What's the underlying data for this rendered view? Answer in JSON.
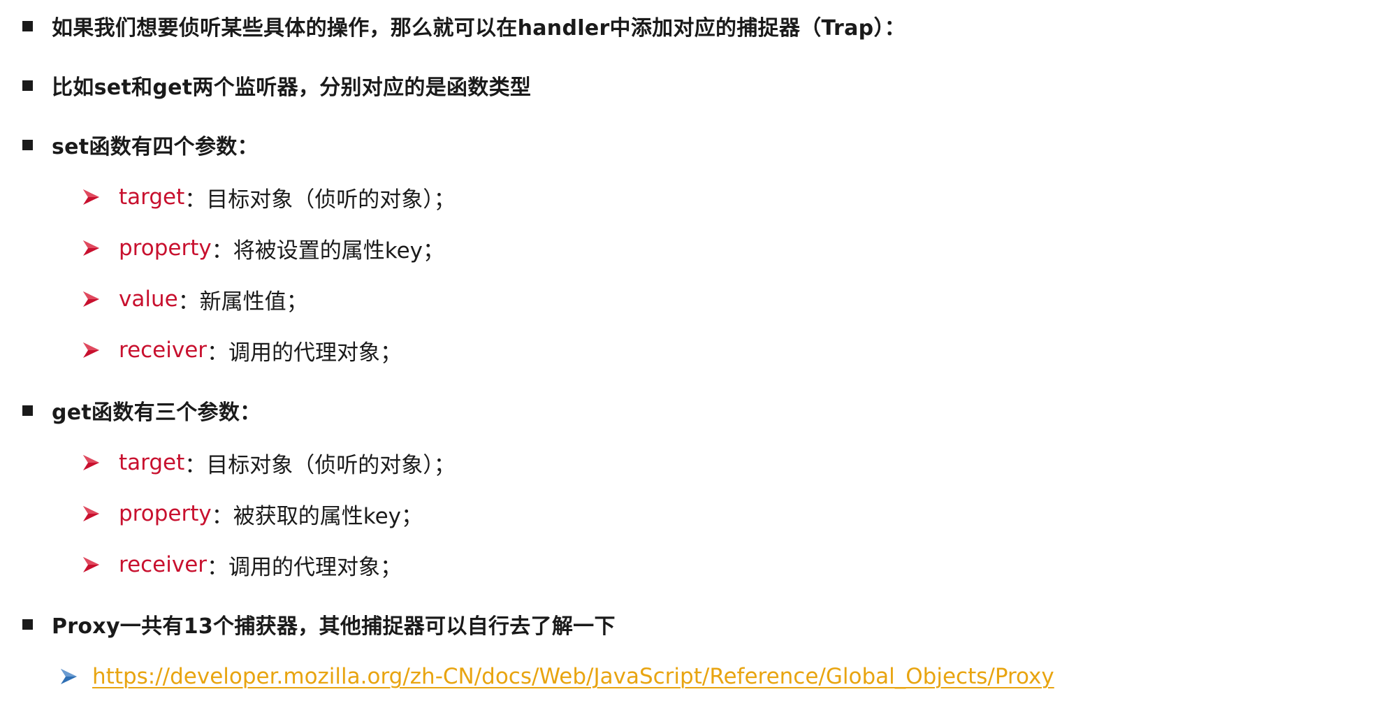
{
  "bullets": {
    "intro": "如果我们想要侦听某些具体的操作，那么就可以在handler中添加对应的捕捉器（Trap）：",
    "example": "比如set和get两个监听器，分别对应的是函数类型",
    "set_heading": "set函数有四个参数：",
    "get_heading": "get函数有三个参数：",
    "proxy_note": "Proxy一共有13个捕获器，其他捕捉器可以自行去了解一下"
  },
  "set_params": [
    {
      "name": "target",
      "desc": "：目标对象（侦听的对象）；"
    },
    {
      "name": "property",
      "desc": "：将被设置的属性key；"
    },
    {
      "name": "value",
      "desc": "：新属性值；"
    },
    {
      "name": "receiver",
      "desc": "：调用的代理对象；"
    }
  ],
  "get_params": [
    {
      "name": "target",
      "desc": "：目标对象（侦听的对象）；"
    },
    {
      "name": "property",
      "desc": "：被获取的属性key；"
    },
    {
      "name": "receiver",
      "desc": "：调用的代理对象；"
    }
  ],
  "reference_link": "https://developer.mozilla.org/zh-CN/docs/Web/JavaScript/Reference/Global_Objects/Proxy",
  "colors": {
    "keyword": "#c8102e",
    "link": "#e8a410",
    "param_arrow": "#c8102e",
    "link_arrow": "#2f6fb4"
  },
  "icons": {
    "level1": "square-bullet-icon",
    "level2": "arrow-bullet-icon"
  }
}
